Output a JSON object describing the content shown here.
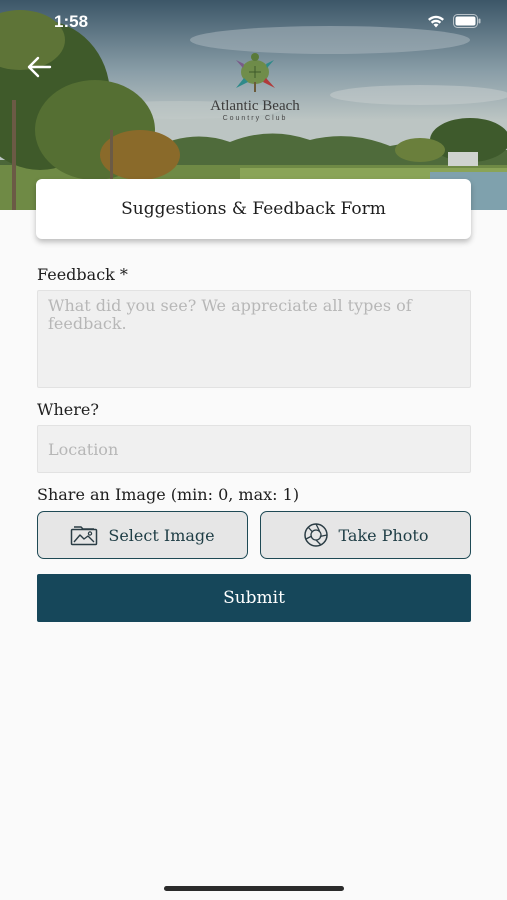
{
  "status_bar": {
    "time": "1:58"
  },
  "header": {
    "logo_name": "Atlantic Beach",
    "logo_subtitle": "Country Club",
    "title": "Suggestions & Feedback Form"
  },
  "form": {
    "feedback": {
      "label": "Feedback *",
      "placeholder": "What did you see? We appreciate all types of feedback.",
      "value": ""
    },
    "where": {
      "label": "Where?",
      "placeholder": "Location",
      "value": ""
    },
    "image": {
      "label": "Share an Image (min: 0, max: 1)",
      "select_label": "Select Image",
      "take_photo_label": "Take Photo"
    },
    "submit_label": "Submit"
  },
  "colors": {
    "primary": "#16475a",
    "button_border": "#1f4a55",
    "field_bg": "#f0f0f0",
    "page_bg": "#fafafa"
  },
  "icons": {
    "back": "arrow-left-icon",
    "select_image": "image-icon",
    "take_photo": "camera-aperture-icon"
  }
}
